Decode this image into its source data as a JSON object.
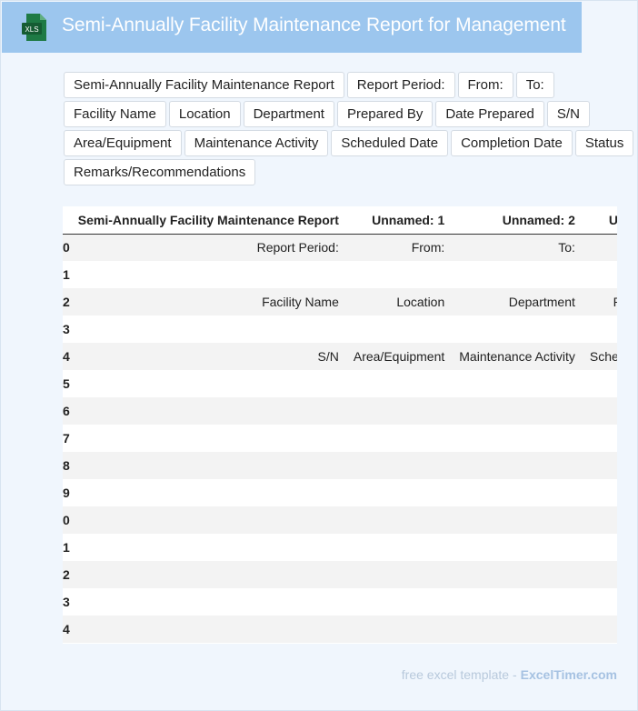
{
  "header": {
    "title": "Semi-Annually Facility Maintenance Report for Management",
    "file_icon_label": "XLS",
    "file_icon_color": "#1e7a45"
  },
  "chips": [
    "Semi-Annually Facility Maintenance Report",
    "Report Period:",
    "From:",
    "To:",
    "Facility Name",
    "Location",
    "Department",
    "Prepared By",
    "Date Prepared",
    "S/N",
    "Area/Equipment",
    "Maintenance Activity",
    "Scheduled Date",
    "Completion Date",
    "Status",
    "Remarks/Recommendations"
  ],
  "table": {
    "columns": [
      "",
      "Semi-Annually Facility Maintenance Report",
      "Unnamed: 1",
      "Unnamed: 2",
      "Un"
    ],
    "rows": [
      [
        "0",
        "Report Period:",
        "From:",
        "To:",
        ""
      ],
      [
        "1",
        "",
        "",
        "",
        ""
      ],
      [
        "2",
        "Facility Name",
        "Location",
        "Department",
        "Pr"
      ],
      [
        "3",
        "",
        "",
        "",
        ""
      ],
      [
        "4",
        "S/N",
        "Area/Equipment",
        "Maintenance Activity",
        "Sched"
      ],
      [
        "5",
        "",
        "",
        "",
        ""
      ],
      [
        "6",
        "",
        "",
        "",
        ""
      ],
      [
        "7",
        "",
        "",
        "",
        ""
      ],
      [
        "8",
        "",
        "",
        "",
        ""
      ],
      [
        "9",
        "",
        "",
        "",
        ""
      ],
      [
        "0",
        "",
        "",
        "",
        ""
      ],
      [
        "1",
        "",
        "",
        "",
        ""
      ],
      [
        "2",
        "",
        "",
        "",
        ""
      ],
      [
        "3",
        "",
        "",
        "",
        ""
      ],
      [
        "4",
        "",
        "",
        "",
        ""
      ]
    ]
  },
  "footer": {
    "text": "free excel template -",
    "brand": "ExcelTimer.com"
  }
}
